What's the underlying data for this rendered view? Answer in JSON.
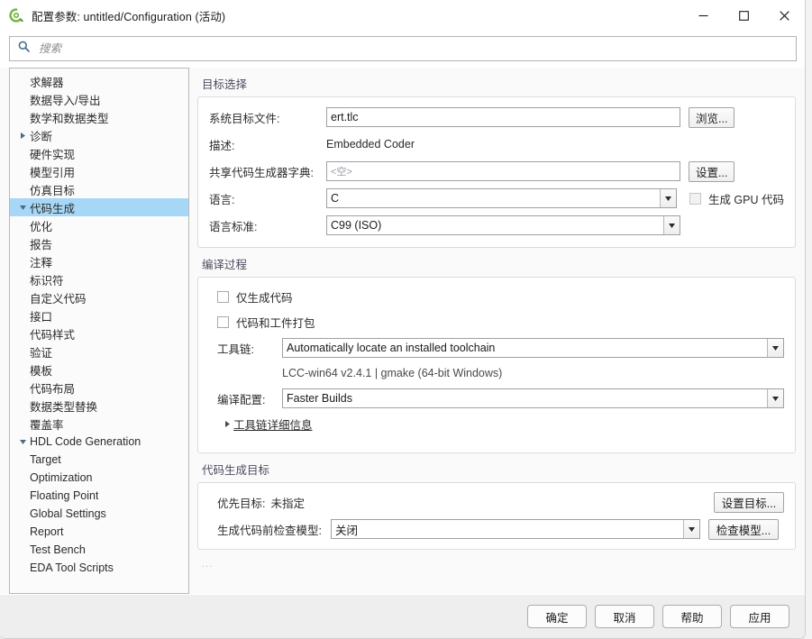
{
  "window": {
    "title": "配置参数: untitled/Configuration (活动)",
    "icon": "simulink-config-icon",
    "controls": {
      "minimize": "minimize-icon",
      "maximize": "maximize-icon",
      "close": "close-icon"
    }
  },
  "search": {
    "icon": "search-icon",
    "placeholder": "搜索",
    "value": ""
  },
  "tree": {
    "items": [
      {
        "label": "求解器",
        "depth": 1,
        "twisty": "none",
        "selected": false
      },
      {
        "label": "数据导入/导出",
        "depth": 1,
        "twisty": "none",
        "selected": false
      },
      {
        "label": "数学和数据类型",
        "depth": 1,
        "twisty": "none",
        "selected": false
      },
      {
        "label": "诊断",
        "depth": 0,
        "twisty": "collapsed",
        "selected": false
      },
      {
        "label": "硬件实现",
        "depth": 1,
        "twisty": "none",
        "selected": false
      },
      {
        "label": "模型引用",
        "depth": 1,
        "twisty": "none",
        "selected": false
      },
      {
        "label": "仿真目标",
        "depth": 1,
        "twisty": "none",
        "selected": false
      },
      {
        "label": "代码生成",
        "depth": 0,
        "twisty": "expanded",
        "selected": true
      },
      {
        "label": "优化",
        "depth": 1,
        "twisty": "none",
        "selected": false
      },
      {
        "label": "报告",
        "depth": 1,
        "twisty": "none",
        "selected": false
      },
      {
        "label": "注释",
        "depth": 1,
        "twisty": "none",
        "selected": false
      },
      {
        "label": "标识符",
        "depth": 1,
        "twisty": "none",
        "selected": false
      },
      {
        "label": "自定义代码",
        "depth": 1,
        "twisty": "none",
        "selected": false
      },
      {
        "label": "接口",
        "depth": 1,
        "twisty": "none",
        "selected": false
      },
      {
        "label": "代码样式",
        "depth": 1,
        "twisty": "none",
        "selected": false
      },
      {
        "label": "验证",
        "depth": 1,
        "twisty": "none",
        "selected": false
      },
      {
        "label": "模板",
        "depth": 1,
        "twisty": "none",
        "selected": false
      },
      {
        "label": "代码布局",
        "depth": 1,
        "twisty": "none",
        "selected": false
      },
      {
        "label": "数据类型替换",
        "depth": 1,
        "twisty": "none",
        "selected": false
      },
      {
        "label": "覆盖率",
        "depth": 1,
        "twisty": "none",
        "selected": false
      },
      {
        "label": "HDL Code Generation",
        "depth": 0,
        "twisty": "expanded",
        "selected": false
      },
      {
        "label": "Target",
        "depth": 1,
        "twisty": "none",
        "selected": false
      },
      {
        "label": "Optimization",
        "depth": 1,
        "twisty": "none",
        "selected": false
      },
      {
        "label": "Floating Point",
        "depth": 1,
        "twisty": "none",
        "selected": false
      },
      {
        "label": "Global Settings",
        "depth": 1,
        "twisty": "none",
        "selected": false
      },
      {
        "label": "Report",
        "depth": 1,
        "twisty": "none",
        "selected": false
      },
      {
        "label": "Test Bench",
        "depth": 1,
        "twisty": "none",
        "selected": false
      },
      {
        "label": "EDA Tool Scripts",
        "depth": 1,
        "twisty": "none",
        "selected": false
      }
    ]
  },
  "target_selection": {
    "section_title": "目标选择",
    "system_target_file": {
      "label": "系统目标文件:",
      "value": "ert.tlc",
      "browse_button": "浏览..."
    },
    "description": {
      "label": "描述:",
      "value": "Embedded Coder"
    },
    "shared_coder_dictionary": {
      "label": "共享代码生成器字典:",
      "value": "",
      "placeholder": "<空>",
      "settings_button": "设置..."
    },
    "language": {
      "label": "语言:",
      "value": "C",
      "gpu_checkbox_label": "生成 GPU 代码",
      "gpu_checkbox_checked": false,
      "gpu_checkbox_enabled": false
    },
    "language_standard": {
      "label": "语言标准:",
      "value": "C99 (ISO)"
    }
  },
  "build_process": {
    "section_title": "编译过程",
    "generate_code_only": {
      "label": "仅生成代码",
      "checked": false
    },
    "package_code_and_artifacts": {
      "label": "代码和工件打包",
      "checked": false
    },
    "toolchain": {
      "label": "工具链:",
      "value": "Automatically locate an installed toolchain",
      "detail": "LCC-win64 v2.4.1 | gmake (64-bit Windows)"
    },
    "build_configuration": {
      "label": "编译配置:",
      "value": "Faster Builds"
    },
    "toolchain_details": {
      "label": "工具链详细信息",
      "expanded": false
    }
  },
  "code_generation_objectives": {
    "section_title": "代码生成目标",
    "priority_objective": {
      "label": "优先目标:",
      "value": "未指定",
      "set_objectives_button": "设置目标..."
    },
    "check_model": {
      "label": "生成代码前检查模型:",
      "value": "关闭",
      "check_model_button": "检查模型..."
    },
    "ellipsis": "..."
  },
  "footer": {
    "ok": "确定",
    "cancel": "取消",
    "help": "帮助",
    "apply": "应用"
  },
  "colors": {
    "tree_selection": "#a6d7f7",
    "search_icon": "#4a6f96",
    "section_title": "#4b4b5e",
    "app_icon_green": "#7bb944",
    "footer_bg": "#eeeeee"
  }
}
